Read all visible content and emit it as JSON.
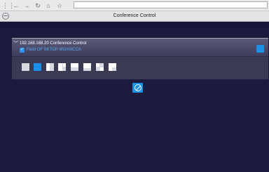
{
  "browser": {
    "buttons": [
      {
        "name": "apps-icon",
        "glyph": "⋮⋮"
      },
      {
        "name": "back-icon",
        "glyph": "←"
      },
      {
        "name": "forward-icon",
        "glyph": "→"
      },
      {
        "name": "reload-icon",
        "glyph": "↻"
      },
      {
        "name": "home-icon",
        "glyph": "⌂"
      },
      {
        "name": "bookmark-icon",
        "glyph": "☆"
      }
    ],
    "address_value": ""
  },
  "window": {
    "title": "Conference Control"
  },
  "panel": {
    "header_text": "192.168.168.20  Conference Control",
    "field_label": "Field OF SKTOP MOXMCCA",
    "checkbox_checked": true,
    "accent_color": "#1c8ee6"
  },
  "layouts": [
    {
      "name": "layout-single",
      "selected": false
    },
    {
      "name": "layout-single-selected",
      "selected": true
    },
    {
      "name": "layout-split-vertical",
      "selected": false
    },
    {
      "name": "layout-split-right",
      "selected": false
    },
    {
      "name": "layout-top-bottom",
      "selected": false
    },
    {
      "name": "layout-pip-corner",
      "selected": false
    },
    {
      "name": "layout-quad",
      "selected": false
    },
    {
      "name": "layout-pip-left",
      "selected": false
    }
  ],
  "stop_button": {
    "icon": "prohibit-icon"
  }
}
